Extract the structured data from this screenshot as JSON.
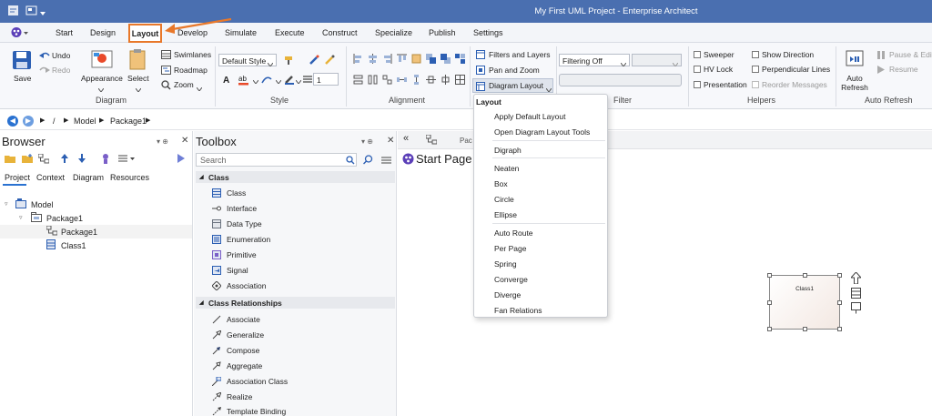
{
  "window": {
    "title": "My First UML Project - Enterprise Architect"
  },
  "menu_tabs": [
    "Start",
    "Design",
    "Layout",
    "Develop",
    "Simulate",
    "Execute",
    "Construct",
    "Specialize",
    "Publish",
    "Settings"
  ],
  "ribbon": {
    "diagram": {
      "label": "Diagram",
      "save": "Save",
      "undo": "Undo",
      "redo": "Redo",
      "appearance": "Appearance",
      "select": "Select",
      "swimlanes": "Swimlanes",
      "roadmap": "Roadmap",
      "zoom": "Zoom"
    },
    "style": {
      "label": "Style",
      "style_value": "Default Style",
      "line_width": "1"
    },
    "alignment": {
      "label": "Alignment"
    },
    "layers": {
      "filters_layers": "Filters and Layers",
      "pan_zoom": "Pan and Zoom",
      "diagram_layout": "Diagram Layout"
    },
    "filter": {
      "label": "Filter",
      "filtering": "Filtering Off"
    },
    "helpers": {
      "label": "Helpers",
      "sweeper": "Sweeper",
      "show_direction": "Show Direction",
      "hv_lock": "HV Lock",
      "perpendicular_lines": "Perpendicular Lines",
      "presentation": "Presentation",
      "reorder_messages": "Reorder Messages"
    },
    "auto_refresh": {
      "label": "Auto Refresh",
      "auto_refresh_btn": "Auto Refresh",
      "pause_edit": "Pause & Edit",
      "resume": "Resume"
    }
  },
  "path": {
    "root": "/",
    "model": "Model",
    "package": "Package1"
  },
  "browser": {
    "title": "Browser",
    "tabs": [
      "Project",
      "Context",
      "Diagram",
      "Resources"
    ],
    "tree": [
      {
        "label": "Model",
        "level": 0
      },
      {
        "label": "Package1",
        "level": 1
      },
      {
        "label": "Package1",
        "level": 2
      },
      {
        "label": "Class1",
        "level": 2
      }
    ]
  },
  "toolbox": {
    "title": "Toolbox",
    "search_placeholder": "Search",
    "sections": [
      {
        "name": "Class",
        "items": [
          "Class",
          "Interface",
          "Data Type",
          "Enumeration",
          "Primitive",
          "Signal",
          "Association"
        ]
      },
      {
        "name": "Class Relationships",
        "items": [
          "Associate",
          "Generalize",
          "Compose",
          "Aggregate",
          "Association Class",
          "Realize",
          "Template Binding"
        ]
      }
    ]
  },
  "diagram": {
    "tab_label": "Start Page",
    "tab_partial": "Pac",
    "element_name": "Class1"
  },
  "layout_menu": {
    "header": "Layout",
    "groups": [
      [
        "Apply Default Layout",
        "Open Diagram Layout Tools"
      ],
      [
        "Digraph"
      ],
      [
        "Neaten",
        "Box",
        "Circle",
        "Ellipse"
      ],
      [
        "Auto Route",
        "Per Page",
        "Spring",
        "Converge",
        "Diverge",
        "Fan Relations"
      ]
    ]
  },
  "colors": {
    "title_bar": "#4a6fb0",
    "highlight": "#e8782a",
    "accent": "#2a72d1"
  }
}
